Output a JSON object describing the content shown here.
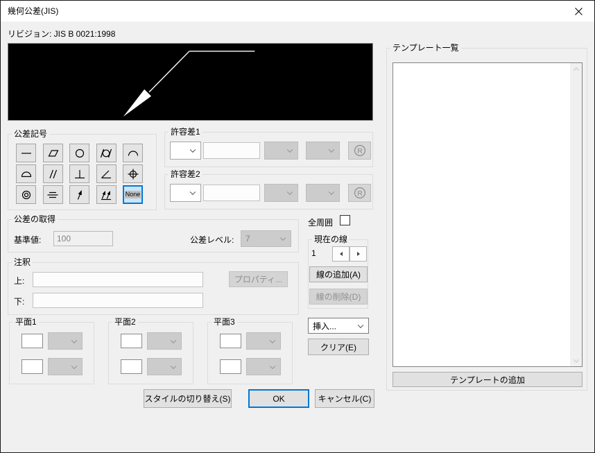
{
  "window": {
    "title": "幾何公差(JIS)"
  },
  "revision": "リビジョン: JIS B 0021:1998",
  "colors": {
    "accent": "#0078d7",
    "preview_bg": "#000000",
    "dialog_bg": "#f0f0f0"
  },
  "symbols": {
    "group_label": "公差記号",
    "items": [
      {
        "name": "straightness"
      },
      {
        "name": "flatness"
      },
      {
        "name": "circularity"
      },
      {
        "name": "cylindricity"
      },
      {
        "name": "line-profile"
      },
      {
        "name": "surface-profile"
      },
      {
        "name": "parallelism"
      },
      {
        "name": "perpendicularity"
      },
      {
        "name": "angularity"
      },
      {
        "name": "position"
      },
      {
        "name": "concentricity"
      },
      {
        "name": "symmetry"
      },
      {
        "name": "circular-runout"
      },
      {
        "name": "total-runout"
      },
      {
        "name": "none",
        "label": "None",
        "selected": true
      }
    ]
  },
  "tolerance1": {
    "group_label": "許容差1",
    "value": "",
    "r_label": "R"
  },
  "tolerance2": {
    "group_label": "許容差2",
    "value": "",
    "r_label": "R"
  },
  "acquisition": {
    "group_label": "公差の取得",
    "base_label": "基準値:",
    "base_value": "100",
    "level_label": "公差レベル:",
    "level_value": "7"
  },
  "annotation": {
    "group_label": "注釈",
    "top_label": "上:",
    "top_value": "",
    "bottom_label": "下:",
    "bottom_value": "",
    "properties_button": "プロパティ..."
  },
  "planes": [
    {
      "group_label": "平面1",
      "value1": "",
      "value2": ""
    },
    {
      "group_label": "平面2",
      "value1": "",
      "value2": ""
    },
    {
      "group_label": "平面3",
      "value1": "",
      "value2": ""
    }
  ],
  "all_around": {
    "label": "全周囲",
    "checked": false
  },
  "current_line": {
    "group_label": "現在の線",
    "value": "1",
    "add_button": "線の追加(A)",
    "delete_button": "線の削除(D)"
  },
  "insert_select": {
    "value": "挿入..."
  },
  "clear_button": "クリア(E)",
  "templates": {
    "group_label": "テンプレート一覧",
    "items": [],
    "add_button": "テンプレートの追加"
  },
  "footer": {
    "style_button": "スタイルの切り替え(S)",
    "ok_button": "OK",
    "cancel_button": "キャンセル(C)"
  }
}
